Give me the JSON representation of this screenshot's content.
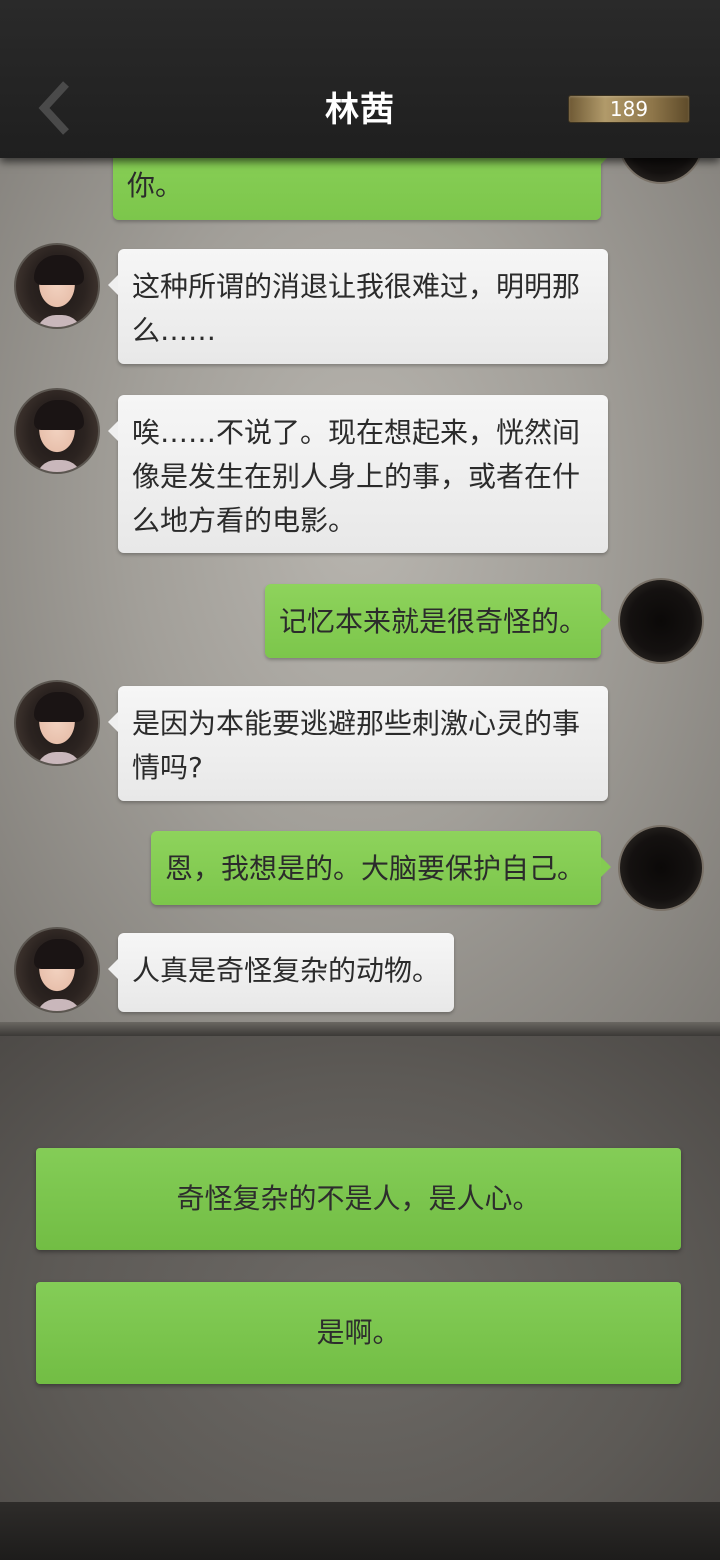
{
  "header": {
    "title": "林茜",
    "coins": "189"
  },
  "messages": [
    {
      "side": "right",
      "text": "你。"
    },
    {
      "side": "left",
      "text": "这种所谓的消退让我很难过，明明那\n么……"
    },
    {
      "side": "left",
      "text": "唉……不说了。现在想起来，恍然间\n像是发生在别人身上的事，或者在什\n么地方看的电影。"
    },
    {
      "side": "right",
      "text": "记忆本来就是很奇怪的。"
    },
    {
      "side": "left",
      "text": "是因为本能要逃避那些刺激心灵的事\n情吗?"
    },
    {
      "side": "right",
      "text": "恩，我想是的。大脑要保护自己。"
    },
    {
      "side": "left",
      "text": "人真是奇怪复杂的动物。"
    }
  ],
  "options": [
    {
      "label": "奇怪复杂的不是人，是人心。"
    },
    {
      "label": "是啊。"
    }
  ],
  "colors": {
    "bubble_green": "#7cc64b",
    "bubble_white": "#efefef",
    "option_green": "#7bc44c",
    "coin_gold": "#b19a6a"
  },
  "icons": {
    "back": "chevron-left-icon"
  }
}
